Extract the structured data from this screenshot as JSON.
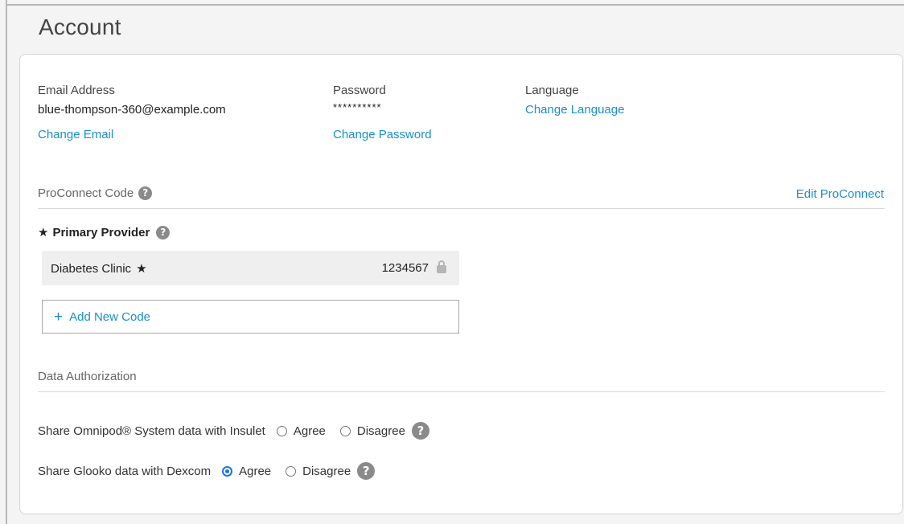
{
  "page": {
    "title": "Account"
  },
  "account": {
    "email_label": "Email Address",
    "email_value": "blue-thompson-360@example.com",
    "change_email": "Change Email",
    "password_label": "Password",
    "password_value": "**********",
    "change_password": "Change Password",
    "language_label": "Language",
    "change_language": "Change Language"
  },
  "proconnect": {
    "title": "ProConnect Code",
    "edit_link": "Edit ProConnect",
    "primary_star": "★",
    "primary_label": "Primary Provider",
    "providers": [
      {
        "name": "Diabetes Clinic",
        "star": "★",
        "code": "1234567",
        "locked": true
      }
    ],
    "add_plus": "+",
    "add_label": "Add New Code"
  },
  "authorization": {
    "title": "Data Authorization",
    "rows": [
      {
        "text": "Share Omnipod® System data with Insulet",
        "agree": "Agree",
        "disagree": "Disagree",
        "selected": "none"
      },
      {
        "text": "Share Glooko data with Dexcom",
        "agree": "Agree",
        "disagree": "Disagree",
        "selected": "agree"
      }
    ]
  },
  "icons": {
    "help": "question-circle-icon",
    "lock": "lock-icon",
    "plus": "plus-icon",
    "star": "star-icon"
  },
  "colors": {
    "link": "#1a8fc9",
    "radio_selected": "#1a73e8",
    "row_bg": "#efefef"
  }
}
